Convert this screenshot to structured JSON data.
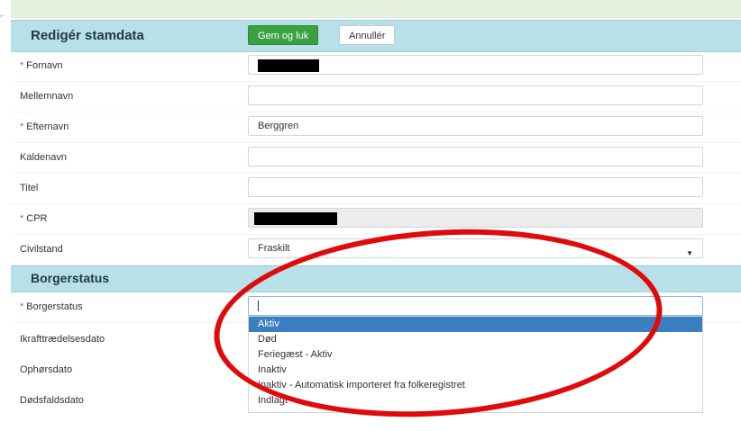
{
  "header": {
    "title": "Redigér stamdata",
    "save_label": "Gem og luk",
    "cancel_label": "Annullér"
  },
  "fields": {
    "fornavn": {
      "label": "Fornavn",
      "required": true,
      "value": ""
    },
    "mellemnavn": {
      "label": "Mellemnavn",
      "required": false,
      "value": ""
    },
    "efternavn": {
      "label": "Efternavn",
      "required": true,
      "value": "Berggren"
    },
    "kaldenavn": {
      "label": "Kaldenavn",
      "required": false,
      "value": ""
    },
    "titel": {
      "label": "Titel",
      "required": false,
      "value": ""
    },
    "cpr": {
      "label": "CPR",
      "required": true,
      "value": ""
    },
    "civilstand": {
      "label": "Civilstand",
      "required": false,
      "value": "Fraskilt"
    }
  },
  "section2": {
    "title": "Borgerstatus",
    "borgerstatus_label": "Borgerstatus",
    "ikraft_label": "Ikrafttrædelsesdato",
    "ophoer_label": "Ophørsdato",
    "doedsfald_label": "Dødsfaldsdato",
    "required_mark": "*"
  },
  "dropdown": {
    "options": [
      "Aktiv",
      "Død",
      "Feriegæst - Aktiv",
      "Inaktiv",
      "Inaktiv - Automatisk importeret fra folkeregistret",
      "Indlagt"
    ],
    "selected_index": 0
  },
  "colors": {
    "section_bar": "#b7e0e8",
    "save_button": "#3aa142",
    "selected_option": "#3a7fc1",
    "annotation": "#e10a0a",
    "required_mark": "#d9534f"
  }
}
